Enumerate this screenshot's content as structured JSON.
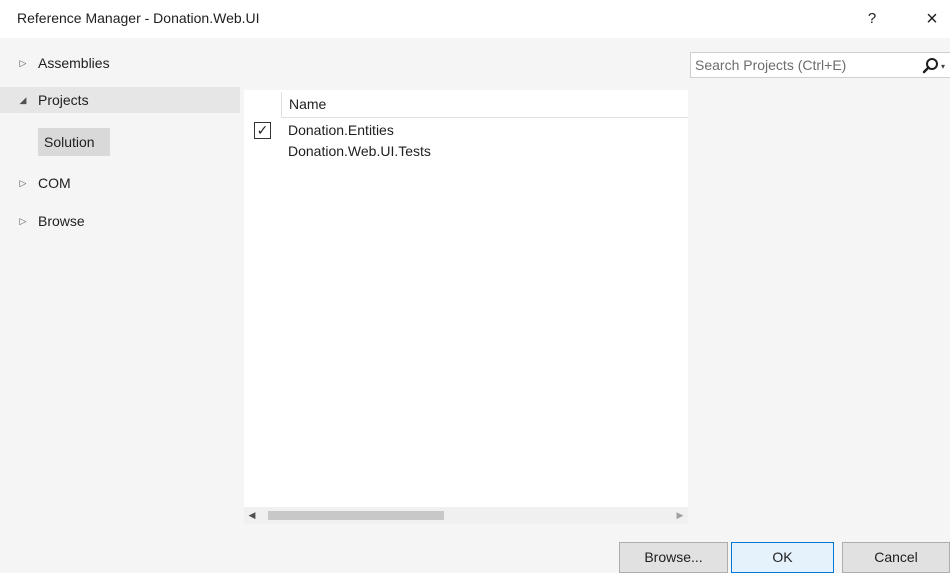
{
  "window": {
    "title": "Reference Manager - Donation.Web.UI",
    "help_glyph": "?",
    "close_glyph": "×"
  },
  "nav": {
    "items": [
      {
        "label": "Assemblies",
        "expanded": false
      },
      {
        "label": "Projects",
        "expanded": true,
        "selected": true
      },
      {
        "label": "COM",
        "expanded": false
      },
      {
        "label": "Browse",
        "expanded": false
      }
    ],
    "sub_items": [
      {
        "label": "Solution",
        "selected": true
      }
    ],
    "arrow_collapsed": "▷",
    "arrow_expanded": "◢"
  },
  "list": {
    "column_header": "Name",
    "rows": [
      {
        "name": "Donation.Entities",
        "checked": true
      },
      {
        "name": "Donation.Web.UI.Tests",
        "checked": false
      }
    ],
    "check_glyph": "✓"
  },
  "scrollbar": {
    "left_arrow": "◀",
    "right_arrow": "▶"
  },
  "search": {
    "placeholder": "Search Projects (Ctrl+E)",
    "value": "",
    "dropdown_glyph": "▾"
  },
  "buttons": {
    "browse": "Browse...",
    "ok": "OK",
    "cancel": "Cancel"
  },
  "colors": {
    "accent": "#0078d7",
    "nav_selected_bg": "#e6e6e6",
    "sub_selected_bg": "#d9d9d9"
  }
}
